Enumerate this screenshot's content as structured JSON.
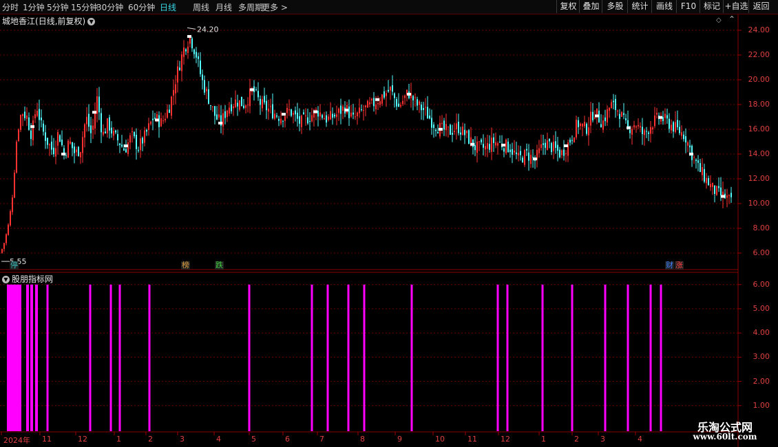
{
  "toolbar": {
    "timeframes": [
      "分时",
      "1分钟",
      "5分钟",
      "15分钟",
      "30分钟",
      "60分钟",
      "日线",
      "周线",
      "月线",
      "多周期",
      "更多 >"
    ],
    "active_timeframe": "日线",
    "right_buttons": [
      "复权",
      "叠加",
      "多股",
      "统计",
      "画线",
      "F10",
      "标记",
      "+自选",
      "返回"
    ]
  },
  "chart_header": {
    "stock_name": "城地香江",
    "period_label": "(日线,前复权)",
    "menu_icon": "chevron-down-icon"
  },
  "price_panel": {
    "y_ticks": [
      "24.00",
      "22.00",
      "20.00",
      "18.00",
      "16.00",
      "14.00",
      "12.00",
      "10.00",
      "8.00",
      "6.00"
    ],
    "high_label": "24.20",
    "low_label": "5.55",
    "event_tags": [
      {
        "text": "停",
        "color": "#3ac0c0"
      },
      {
        "text": "榜",
        "color": "#e0a040"
      },
      {
        "text": "跌",
        "color": "#40d040"
      },
      {
        "text": "财",
        "color": "#4080ff"
      },
      {
        "text": "涨",
        "color": "#ff4040"
      }
    ]
  },
  "indicator_panel": {
    "title": "股朋指标网",
    "y_ticks": [
      "6.00",
      "5.00",
      "4.00",
      "3.00",
      "2.00",
      "1.00"
    ],
    "bar_color": "#ff00ff",
    "signal_value": 6
  },
  "x_axis": {
    "labels": [
      "2024年",
      "11",
      "12",
      "1",
      "2",
      "3",
      "4",
      "5",
      "6",
      "7",
      "8",
      "9",
      "10",
      "11",
      "12",
      "1",
      "2",
      "3",
      "4"
    ]
  },
  "watermark": {
    "title": "乐淘公式网",
    "url": "www.60lt.com"
  },
  "colors": {
    "up": "#ff3232",
    "down": "#54ffff",
    "grid": "#700000",
    "axis_text": "#e04040",
    "active_tab": "#38d9e8"
  },
  "chart_data": {
    "type": "candlestick",
    "close_path": [
      {
        "d": 0,
        "p": 6.0
      },
      {
        "d": 6,
        "p": 7.0
      },
      {
        "d": 12,
        "p": 8.5
      },
      {
        "d": 18,
        "p": 11.0
      },
      {
        "d": 23,
        "p": 15.0
      },
      {
        "d": 30,
        "p": 17.5
      },
      {
        "d": 38,
        "p": 17.0
      },
      {
        "d": 45,
        "p": 15.5
      },
      {
        "d": 52,
        "p": 18.0
      },
      {
        "d": 60,
        "p": 16.0
      },
      {
        "d": 68,
        "p": 15.0
      },
      {
        "d": 76,
        "p": 14.2
      },
      {
        "d": 84,
        "p": 15.8
      },
      {
        "d": 92,
        "p": 14.0
      },
      {
        "d": 100,
        "p": 15.0
      },
      {
        "d": 108,
        "p": 14.0
      },
      {
        "d": 116,
        "p": 14.5
      },
      {
        "d": 124,
        "p": 17.0
      },
      {
        "d": 132,
        "p": 15.5
      },
      {
        "d": 140,
        "p": 18.5
      },
      {
        "d": 148,
        "p": 15.5
      },
      {
        "d": 156,
        "p": 16.5
      },
      {
        "d": 164,
        "p": 15.5
      },
      {
        "d": 172,
        "p": 15.0
      },
      {
        "d": 180,
        "p": 14.3
      },
      {
        "d": 190,
        "p": 15.5
      },
      {
        "d": 200,
        "p": 14.5
      },
      {
        "d": 210,
        "p": 15.5
      },
      {
        "d": 222,
        "p": 17.0
      },
      {
        "d": 234,
        "p": 16.5
      },
      {
        "d": 246,
        "p": 18.0
      },
      {
        "d": 256,
        "p": 20.5
      },
      {
        "d": 266,
        "p": 22.5
      },
      {
        "d": 275,
        "p": 23.5
      },
      {
        "d": 284,
        "p": 22.0
      },
      {
        "d": 292,
        "p": 20.0
      },
      {
        "d": 302,
        "p": 18.5
      },
      {
        "d": 312,
        "p": 17.0
      },
      {
        "d": 320,
        "p": 16.5
      },
      {
        "d": 330,
        "p": 17.8
      },
      {
        "d": 342,
        "p": 18.3
      },
      {
        "d": 354,
        "p": 18.0
      },
      {
        "d": 366,
        "p": 19.2
      },
      {
        "d": 378,
        "p": 18.0
      },
      {
        "d": 392,
        "p": 17.5
      },
      {
        "d": 406,
        "p": 17.0
      },
      {
        "d": 420,
        "p": 17.5
      },
      {
        "d": 435,
        "p": 16.5
      },
      {
        "d": 448,
        "p": 17.0
      },
      {
        "d": 460,
        "p": 17.5
      },
      {
        "d": 474,
        "p": 16.8
      },
      {
        "d": 488,
        "p": 17.2
      },
      {
        "d": 500,
        "p": 17.8
      },
      {
        "d": 512,
        "p": 16.8
      },
      {
        "d": 525,
        "p": 17.5
      },
      {
        "d": 540,
        "p": 18.0
      },
      {
        "d": 552,
        "p": 18.6
      },
      {
        "d": 566,
        "p": 19.2
      },
      {
        "d": 578,
        "p": 17.8
      },
      {
        "d": 592,
        "p": 19.0
      },
      {
        "d": 604,
        "p": 18.0
      },
      {
        "d": 616,
        "p": 17.5
      },
      {
        "d": 628,
        "p": 16.5
      },
      {
        "d": 640,
        "p": 16.0
      },
      {
        "d": 652,
        "p": 15.8
      },
      {
        "d": 664,
        "p": 16.2
      },
      {
        "d": 676,
        "p": 15.5
      },
      {
        "d": 690,
        "p": 14.5
      },
      {
        "d": 704,
        "p": 14.5
      },
      {
        "d": 716,
        "p": 15.0
      },
      {
        "d": 728,
        "p": 14.8
      },
      {
        "d": 740,
        "p": 14.5
      },
      {
        "d": 752,
        "p": 13.6
      },
      {
        "d": 764,
        "p": 14.0
      },
      {
        "d": 776,
        "p": 13.5
      },
      {
        "d": 790,
        "p": 15.0
      },
      {
        "d": 802,
        "p": 14.5
      },
      {
        "d": 814,
        "p": 14.0
      },
      {
        "d": 826,
        "p": 15.0
      },
      {
        "d": 838,
        "p": 16.5
      },
      {
        "d": 850,
        "p": 16.0
      },
      {
        "d": 862,
        "p": 17.5
      },
      {
        "d": 874,
        "p": 16.5
      },
      {
        "d": 886,
        "p": 18.0
      },
      {
        "d": 898,
        "p": 17.5
      },
      {
        "d": 910,
        "p": 16.0
      },
      {
        "d": 922,
        "p": 16.5
      },
      {
        "d": 934,
        "p": 15.5
      },
      {
        "d": 946,
        "p": 16.5
      },
      {
        "d": 958,
        "p": 17.0
      },
      {
        "d": 970,
        "p": 16.5
      },
      {
        "d": 982,
        "p": 16.0
      },
      {
        "d": 994,
        "p": 15.5
      },
      {
        "d": 1004,
        "p": 14.0
      },
      {
        "d": 1014,
        "p": 12.8
      },
      {
        "d": 1024,
        "p": 12.0
      },
      {
        "d": 1034,
        "p": 11.2
      },
      {
        "d": 1044,
        "p": 10.7
      },
      {
        "d": 1054,
        "p": 10.5
      },
      {
        "d": 1062,
        "p": 10.0
      }
    ],
    "y_range": [
      5.0,
      25.0
    ],
    "signal_bars": [
      {
        "d": 12,
        "w": 4
      },
      {
        "d": 18,
        "w": 8
      },
      {
        "d": 26,
        "w": 10
      },
      {
        "d": 40,
        "w": 4
      },
      {
        "d": 46,
        "w": 4
      },
      {
        "d": 53,
        "w": 4
      },
      {
        "d": 69,
        "w": 3
      },
      {
        "d": 131,
        "w": 3
      },
      {
        "d": 161,
        "w": 3
      },
      {
        "d": 174,
        "w": 3
      },
      {
        "d": 217,
        "w": 3
      },
      {
        "d": 362,
        "w": 3
      },
      {
        "d": 453,
        "w": 3
      },
      {
        "d": 476,
        "w": 3
      },
      {
        "d": 506,
        "w": 3
      },
      {
        "d": 529,
        "w": 3
      },
      {
        "d": 598,
        "w": 3
      },
      {
        "d": 723,
        "w": 3
      },
      {
        "d": 737,
        "w": 3
      },
      {
        "d": 788,
        "w": 3
      },
      {
        "d": 831,
        "w": 3
      },
      {
        "d": 879,
        "w": 3
      },
      {
        "d": 912,
        "w": 3
      },
      {
        "d": 945,
        "w": 3
      },
      {
        "d": 960,
        "w": 3
      }
    ]
  }
}
